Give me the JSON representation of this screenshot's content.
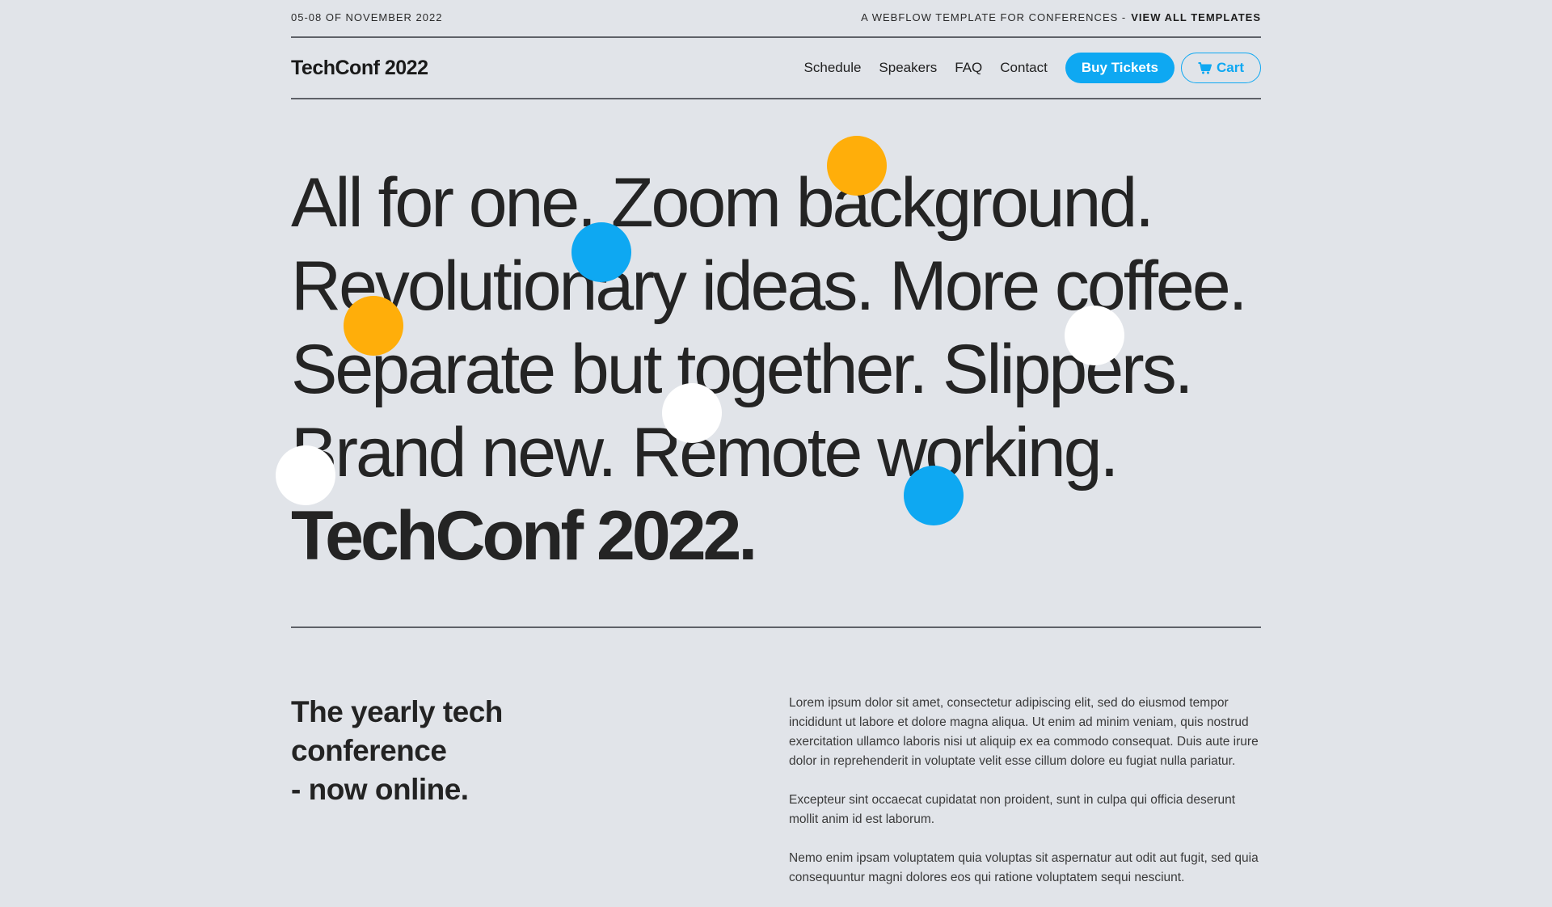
{
  "topbar": {
    "date": "05-08 OF NOVEMBER 2022",
    "tagline": "A WEBFLOW TEMPLATE FOR CONFERENCES -",
    "link": "VIEW ALL TEMPLATES"
  },
  "nav": {
    "logo": "TechConf 2022",
    "items": [
      {
        "label": "Schedule"
      },
      {
        "label": "Speakers"
      },
      {
        "label": "FAQ"
      },
      {
        "label": "Contact"
      }
    ],
    "buy_label": "Buy Tickets",
    "cart_label": "Cart",
    "cart_icon": "cart-icon"
  },
  "hero": {
    "lines": [
      "All for one. Zoom background.",
      "Revolutionary ideas. More coffee.",
      "Separate but together. Slippers.",
      "Brand new. Remote working.",
      "TechConf 2022."
    ]
  },
  "about": {
    "title_lines": [
      "The yearly tech",
      "conference",
      "- now online."
    ],
    "paragraphs": [
      "Lorem ipsum dolor sit amet, consectetur adipiscing elit, sed do eiusmod tempor incididunt ut labore et dolore magna aliqua. Ut enim ad minim veniam, quis nostrud exercitation ullamco laboris nisi ut aliquip ex ea commodo consequat. Duis aute irure dolor in reprehenderit in voluptate velit esse cillum dolore eu fugiat nulla pariatur.",
      "Excepteur sint occaecat cupidatat non proident, sunt in culpa qui officia deserunt mollit anim id est laborum.",
      "Nemo enim ipsam voluptatem quia voluptas sit aspernatur aut odit aut fugit, sed quia consequuntur magni dolores eos qui ratione voluptatem sequi nesciunt."
    ]
  },
  "colors": {
    "background": "#e1e4e9",
    "accent_blue": "#0ea8f2",
    "accent_orange": "#ffae0a",
    "text": "#232323"
  }
}
